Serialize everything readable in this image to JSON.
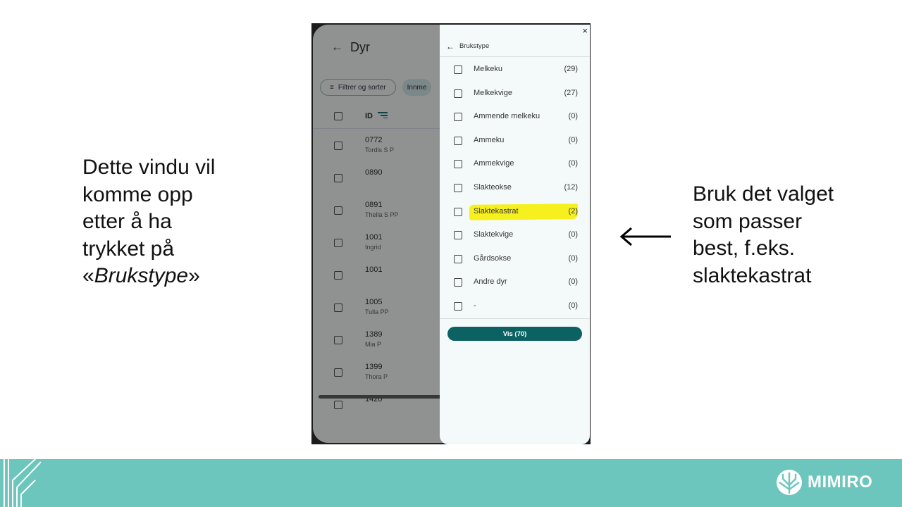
{
  "slide": {
    "left_text": [
      "Dette vindu vil",
      "komme opp",
      "etter å ha",
      "trykket på"
    ],
    "left_text_last": {
      "open_quote": "«",
      "italic": "Brukstype",
      "close_quote": "»"
    },
    "right_text": [
      "Bruk det valget",
      "som passer",
      "best, f.eks.",
      "slaktekastrat"
    ]
  },
  "app": {
    "title": "Dyr",
    "chips": {
      "filter": "Filtrer og sorter",
      "partial": "Innme"
    },
    "id_header": "ID",
    "rows": [
      {
        "id": "0772",
        "name": "Tordis S P"
      },
      {
        "id": "0890",
        "name": ""
      },
      {
        "id": "0891",
        "name": "Thella S PP"
      },
      {
        "id": "1001",
        "name": "Ingrid"
      },
      {
        "id": "1001",
        "name": ""
      },
      {
        "id": "1005",
        "name": "Tulla PP"
      },
      {
        "id": "1389",
        "name": "Mia P"
      },
      {
        "id": "1399",
        "name": "Thora P"
      },
      {
        "id": "1420",
        "name": ""
      }
    ]
  },
  "panel": {
    "close": "×",
    "title": "Brukstype",
    "options": [
      {
        "label": "Melkeku",
        "count": "(29)"
      },
      {
        "label": "Melkekvige",
        "count": "(27)"
      },
      {
        "label": "Ammende melkeku",
        "count": "(0)"
      },
      {
        "label": "Ammeku",
        "count": "(0)"
      },
      {
        "label": "Ammekvige",
        "count": "(0)"
      },
      {
        "label": "Slakteokse",
        "count": "(12)"
      },
      {
        "label": "Slaktekastrat",
        "count": "(2)"
      },
      {
        "label": "Slaktekvige",
        "count": "(0)"
      },
      {
        "label": "Gårdsokse",
        "count": "(0)"
      },
      {
        "label": "Andre dyr",
        "count": "(0)"
      },
      {
        "label": "-",
        "count": "(0)"
      }
    ],
    "highlighted_option": "Slaktekastrat",
    "button": "Vis (70)"
  },
  "footer": {
    "brand": "MIMIRO"
  },
  "colors": {
    "accent": "#0c6163",
    "footer": "#6cc6bd",
    "highlight": "#f6f01e"
  }
}
